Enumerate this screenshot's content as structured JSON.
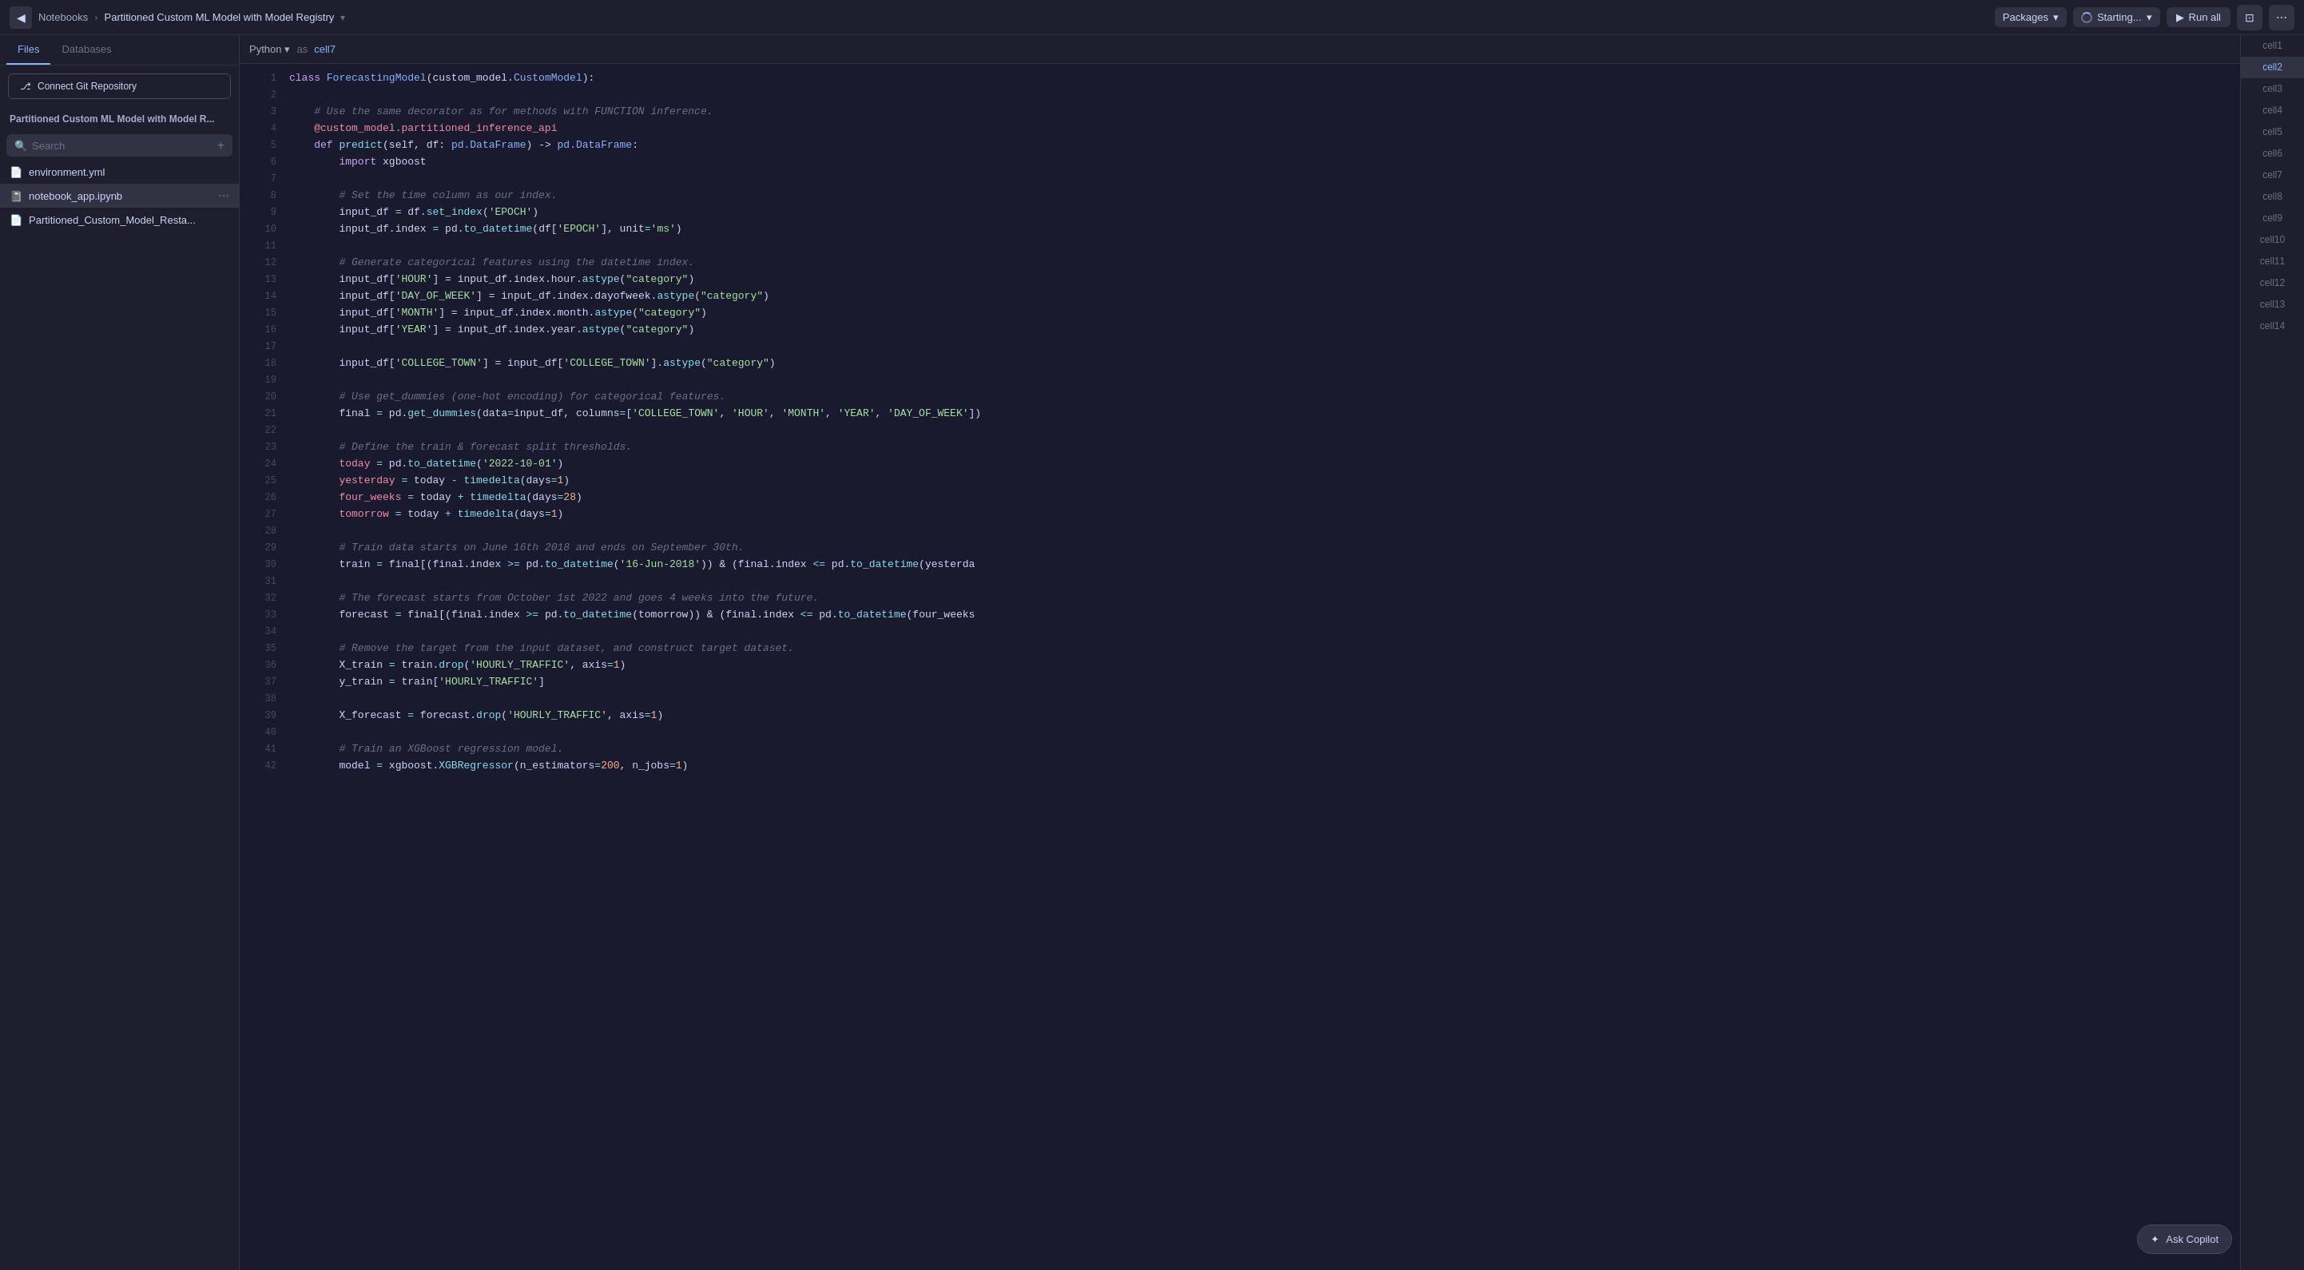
{
  "topbar": {
    "back_label": "◀",
    "notebooks_label": "Notebooks",
    "notebook_title": "Partitioned Custom ML Model with Model Registry",
    "chevron": "▾",
    "packages_label": "Packages",
    "status_label": "Starting...",
    "run_all_label": "Run all",
    "more_icon": "⋯"
  },
  "sidebar": {
    "tabs": [
      {
        "label": "Files",
        "active": true
      },
      {
        "label": "Databases",
        "active": false
      }
    ],
    "connect_git_label": "Connect Git Repository",
    "project_title": "Partitioned Custom ML Model with Model R...",
    "search_placeholder": "Search",
    "add_icon": "+",
    "files": [
      {
        "name": "environment.yml",
        "icon": "📄",
        "active": false
      },
      {
        "name": "notebook_app.ipynb",
        "icon": "📓",
        "active": true
      },
      {
        "name": "Partitioned_Custom_Model_Resta...",
        "icon": "📄",
        "active": false
      }
    ]
  },
  "editor": {
    "language": "Python",
    "lang_chevron": "▾",
    "as_label": "as",
    "cell_ref": "cell7",
    "lines": [
      {
        "num": 1,
        "code": "class ForecastingModel(custom_model.CustomModel):"
      },
      {
        "num": 2,
        "code": ""
      },
      {
        "num": 3,
        "code": "    # Use the same decorator as for methods with FUNCTION inference."
      },
      {
        "num": 4,
        "code": "    @custom_model.partitioned_inference_api"
      },
      {
        "num": 5,
        "code": "    def predict(self, df: pd.DataFrame) -> pd.DataFrame:"
      },
      {
        "num": 6,
        "code": "        import xgboost"
      },
      {
        "num": 7,
        "code": ""
      },
      {
        "num": 8,
        "code": "        # Set the time column as our index."
      },
      {
        "num": 9,
        "code": "        input_df = df.set_index('EPOCH')"
      },
      {
        "num": 10,
        "code": "        input_df.index = pd.to_datetime(df['EPOCH'], unit='ms')"
      },
      {
        "num": 11,
        "code": ""
      },
      {
        "num": 12,
        "code": "        # Generate categorical features using the datetime index."
      },
      {
        "num": 13,
        "code": "        input_df['HOUR'] = input_df.index.hour.astype(\"category\")"
      },
      {
        "num": 14,
        "code": "        input_df['DAY_OF_WEEK'] = input_df.index.dayofweek.astype(\"category\")"
      },
      {
        "num": 15,
        "code": "        input_df['MONTH'] = input_df.index.month.astype(\"category\")"
      },
      {
        "num": 16,
        "code": "        input_df['YEAR'] = input_df.index.year.astype(\"category\")"
      },
      {
        "num": 17,
        "code": ""
      },
      {
        "num": 18,
        "code": "        input_df['COLLEGE_TOWN'] = input_df['COLLEGE_TOWN'].astype(\"category\")"
      },
      {
        "num": 19,
        "code": ""
      },
      {
        "num": 20,
        "code": "        # Use get_dummies (one-hot encoding) for categorical features."
      },
      {
        "num": 21,
        "code": "        final = pd.get_dummies(data=input_df, columns=['COLLEGE_TOWN', 'HOUR', 'MONTH', 'YEAR', 'DAY_OF_WEEK'])"
      },
      {
        "num": 22,
        "code": ""
      },
      {
        "num": 23,
        "code": "        # Define the train & forecast split thresholds."
      },
      {
        "num": 24,
        "code": "        today = pd.to_datetime('2022-10-01')"
      },
      {
        "num": 25,
        "code": "        yesterday = today - timedelta(days=1)"
      },
      {
        "num": 26,
        "code": "        four_weeks = today + timedelta(days=28)"
      },
      {
        "num": 27,
        "code": "        tomorrow = today + timedelta(days=1)"
      },
      {
        "num": 28,
        "code": ""
      },
      {
        "num": 29,
        "code": "        # Train data starts on June 16th 2018 and ends on September 30th."
      },
      {
        "num": 30,
        "code": "        train = final[(final.index >= pd.to_datetime('16-Jun-2018')) & (final.index <= pd.to_datetime(yesterda"
      },
      {
        "num": 31,
        "code": ""
      },
      {
        "num": 32,
        "code": "        # The forecast starts from October 1st 2022 and goes 4 weeks into the future."
      },
      {
        "num": 33,
        "code": "        forecast = final[(final.index >= pd.to_datetime(tomorrow)) & (final.index <= pd.to_datetime(four_weeks"
      },
      {
        "num": 34,
        "code": ""
      },
      {
        "num": 35,
        "code": "        # Remove the target from the input dataset, and construct target dataset."
      },
      {
        "num": 36,
        "code": "        X_train = train.drop('HOURLY_TRAFFIC', axis=1)"
      },
      {
        "num": 37,
        "code": "        y_train = train['HOURLY_TRAFFIC']"
      },
      {
        "num": 38,
        "code": ""
      },
      {
        "num": 39,
        "code": "        X_forecast = forecast.drop('HOURLY_TRAFFIC', axis=1)"
      },
      {
        "num": 40,
        "code": ""
      },
      {
        "num": 41,
        "code": "        # Train an XGBoost regression model."
      },
      {
        "num": 42,
        "code": "        model = xgboost.XGBRegressor(n_estimators=200, n_jobs=1)"
      }
    ]
  },
  "cells": {
    "items": [
      {
        "label": "cell1",
        "active": false
      },
      {
        "label": "cell2",
        "active": true
      },
      {
        "label": "cell3",
        "active": false
      },
      {
        "label": "cell4",
        "active": false
      },
      {
        "label": "cell5",
        "active": false
      },
      {
        "label": "cell6",
        "active": false
      },
      {
        "label": "cell7",
        "active": false
      },
      {
        "label": "cell8",
        "active": false
      },
      {
        "label": "cell9",
        "active": false
      },
      {
        "label": "cell10",
        "active": false
      },
      {
        "label": "cell11",
        "active": false
      },
      {
        "label": "cell12",
        "active": false
      },
      {
        "label": "cell13",
        "active": false
      },
      {
        "label": "cell14",
        "active": false
      }
    ]
  },
  "copilot": {
    "label": "Ask Copilot",
    "icon": "✦"
  }
}
